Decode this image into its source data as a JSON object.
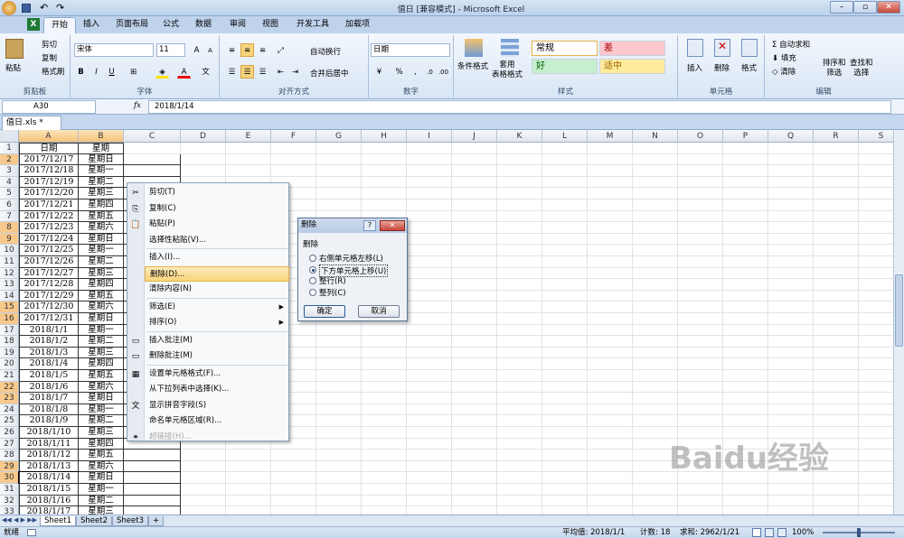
{
  "titlebar": {
    "title": "值日  [兼容模式] - Microsoft Excel"
  },
  "quick_access": {
    "undo": "↶",
    "redo": "↷"
  },
  "tabs": [
    {
      "label": "开始",
      "active": true
    },
    {
      "label": "插入"
    },
    {
      "label": "页面布局"
    },
    {
      "label": "公式"
    },
    {
      "label": "数据"
    },
    {
      "label": "审阅"
    },
    {
      "label": "视图"
    },
    {
      "label": "开发工具"
    },
    {
      "label": "加载项"
    }
  ],
  "ribbon": {
    "clipboard": {
      "paste": "粘贴",
      "cut": "剪切",
      "copy": "复制",
      "format_painter": "格式刷",
      "label": "剪贴板"
    },
    "font": {
      "name": "宋体",
      "size": "11",
      "bold": "B",
      "italic": "I",
      "underline": "U",
      "label": "字体"
    },
    "alignment": {
      "wrap": "自动换行",
      "merge": "合并后居中",
      "label": "对齐方式"
    },
    "number": {
      "format": "日期",
      "percent": "%",
      "comma": ",",
      "label": "数字"
    },
    "styles": {
      "conditional": "条件格式",
      "table": "套用\n表格格式",
      "normal": "常规",
      "bad": "差",
      "good": "好",
      "neutral": "适中",
      "label": "样式"
    },
    "cells": {
      "insert": "插入",
      "delete": "删除",
      "format": "格式",
      "label": "单元格"
    },
    "editing": {
      "autosum": "自动求和",
      "fill": "填充",
      "clear": "清除",
      "sort": "排序和\n筛选",
      "find": "查找和\n选择",
      "label": "编辑"
    }
  },
  "formula_bar": {
    "name_box": "A30",
    "fx": "fx",
    "value": "2018/1/14"
  },
  "doc_tab": {
    "name": "值日.xls *"
  },
  "columns": [
    "A",
    "B",
    "C",
    "D",
    "E",
    "F",
    "G",
    "H",
    "I",
    "J",
    "K",
    "L",
    "M",
    "N",
    "O",
    "P",
    "Q",
    "R",
    "S",
    "T"
  ],
  "header_row": {
    "a": "日期",
    "b": "星期"
  },
  "rows": [
    {
      "n": "2",
      "a": "2017/12/17",
      "b": "星期日",
      "sel": true
    },
    {
      "n": "3",
      "a": "2017/12/18",
      "b": "星期一"
    },
    {
      "n": "4",
      "a": "2017/12/19",
      "b": "星期二"
    },
    {
      "n": "5",
      "a": "2017/12/20",
      "b": "星期三"
    },
    {
      "n": "6",
      "a": "2017/12/21",
      "b": "星期四"
    },
    {
      "n": "7",
      "a": "2017/12/22",
      "b": "星期五"
    },
    {
      "n": "8",
      "a": "2017/12/23",
      "b": "星期六",
      "sel": true
    },
    {
      "n": "9",
      "a": "2017/12/24",
      "b": "星期日",
      "sel": true
    },
    {
      "n": "10",
      "a": "2017/12/25",
      "b": "星期一"
    },
    {
      "n": "11",
      "a": "2017/12/26",
      "b": "星期二"
    },
    {
      "n": "12",
      "a": "2017/12/27",
      "b": "星期三"
    },
    {
      "n": "13",
      "a": "2017/12/28",
      "b": "星期四"
    },
    {
      "n": "14",
      "a": "2017/12/29",
      "b": "星期五"
    },
    {
      "n": "15",
      "a": "2017/12/30",
      "b": "星期六",
      "sel": true
    },
    {
      "n": "16",
      "a": "2017/12/31",
      "b": "星期日",
      "sel": true
    },
    {
      "n": "17",
      "a": "2018/1/1",
      "b": "星期一"
    },
    {
      "n": "18",
      "a": "2018/1/2",
      "b": "星期二"
    },
    {
      "n": "19",
      "a": "2018/1/3",
      "b": "星期三"
    },
    {
      "n": "20",
      "a": "2018/1/4",
      "b": "星期四"
    },
    {
      "n": "21",
      "a": "2018/1/5",
      "b": "星期五"
    },
    {
      "n": "22",
      "a": "2018/1/6",
      "b": "星期六",
      "sel": true
    },
    {
      "n": "23",
      "a": "2018/1/7",
      "b": "星期日",
      "sel": true
    },
    {
      "n": "24",
      "a": "2018/1/8",
      "b": "星期一"
    },
    {
      "n": "25",
      "a": "2018/1/9",
      "b": "星期二"
    },
    {
      "n": "26",
      "a": "2018/1/10",
      "b": "星期三"
    },
    {
      "n": "27",
      "a": "2018/1/11",
      "b": "星期四"
    },
    {
      "n": "28",
      "a": "2018/1/12",
      "b": "星期五"
    },
    {
      "n": "29",
      "a": "2018/1/13",
      "b": "星期六",
      "sel": true
    },
    {
      "n": "30",
      "a": "2018/1/14",
      "b": "星期日",
      "sel": true
    },
    {
      "n": "31",
      "a": "2018/1/15",
      "b": "星期一"
    },
    {
      "n": "32",
      "a": "2018/1/16",
      "b": "星期二"
    },
    {
      "n": "33",
      "a": "2018/1/17",
      "b": "星期三"
    }
  ],
  "context_menu": [
    {
      "label": "剪切(T)",
      "icon": "✂"
    },
    {
      "label": "复制(C)",
      "icon": "⎘"
    },
    {
      "label": "粘贴(P)",
      "icon": "📋"
    },
    {
      "label": "选择性粘贴(V)...",
      "sep_after": true
    },
    {
      "label": "插入(I)..."
    },
    {
      "label": "删除(D)...",
      "highlight": true
    },
    {
      "label": "清除内容(N)",
      "sep_after": true
    },
    {
      "label": "筛选(E)",
      "submenu": true
    },
    {
      "label": "排序(O)",
      "submenu": true,
      "sep_after": true
    },
    {
      "label": "插入批注(M)",
      "icon": "▭"
    },
    {
      "label": "删除批注(M)",
      "icon": "▭",
      "sep_after": true
    },
    {
      "label": "设置单元格格式(F)...",
      "icon": "▦"
    },
    {
      "label": "从下拉列表中选择(K)..."
    },
    {
      "label": "显示拼音字段(S)",
      "icon": "文"
    },
    {
      "label": "命名单元格区域(R)..."
    },
    {
      "label": "超链接(H)...",
      "icon": "⚭",
      "disabled": true
    }
  ],
  "dialog": {
    "title": "删除",
    "help": "?",
    "close": "✕",
    "group": "删除",
    "options": [
      "右侧单元格左移(L)",
      "下方单元格上移(U)",
      "整行(R)",
      "整列(C)"
    ],
    "selected": 1,
    "ok": "确定",
    "cancel": "取消"
  },
  "sheet_tabs": [
    "Sheet1",
    "Sheet2",
    "Sheet3"
  ],
  "status": {
    "ready": "就绪",
    "average": "平均值: 2018/1/1",
    "count": "计数: 18",
    "sum": "求和: 2962/1/21",
    "zoom": "100%"
  },
  "watermark": "Baidu经验"
}
